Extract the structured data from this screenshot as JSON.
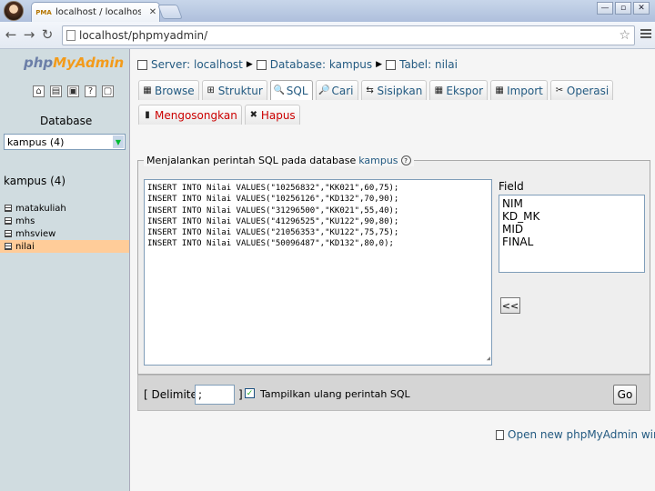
{
  "browser": {
    "tab_title": "localhost / localhost / kampus",
    "tab_close": "✕",
    "url": "localhost/phpmyadmin/",
    "window_buttons": [
      "—",
      "▫",
      "✕"
    ]
  },
  "sidebar": {
    "logo_php": "php",
    "logo_myadmin": "MyAdmin",
    "database_label": "Database",
    "database_select": "kampus (4)",
    "db_name": "kampus (4)",
    "tables": [
      {
        "name": "matakuliah"
      },
      {
        "name": "mhs"
      },
      {
        "name": "mhsview"
      },
      {
        "name": "nilai"
      }
    ]
  },
  "breadcrumb": {
    "server": "Server: localhost",
    "database": "Database: kampus",
    "table": "Tabel: nilai",
    "separator": "▶"
  },
  "tabs_row1": [
    {
      "label": "Browse",
      "icon": "▦"
    },
    {
      "label": "Struktur",
      "icon": "⊞"
    },
    {
      "label": "SQL",
      "icon": "🔍"
    },
    {
      "label": "Cari",
      "icon": "🔎"
    },
    {
      "label": "Sisipkan",
      "icon": "⇆"
    },
    {
      "label": "Ekspor",
      "icon": "▦"
    },
    {
      "label": "Import",
      "icon": "▦"
    },
    {
      "label": "Operasi",
      "icon": "✂"
    }
  ],
  "tabs_row2": [
    {
      "label": "Mengosongkan",
      "icon": "▮"
    },
    {
      "label": "Hapus",
      "icon": "✖"
    }
  ],
  "sql_panel": {
    "legend_text": "Menjalankan perintah SQL pada database",
    "legend_link": "kampus",
    "legend_info": "?",
    "query_lines": [
      "INSERT INTO Nilai VALUES(\"10256832\",\"KK021\",60,75);",
      "INSERT INTO Nilai VALUES(\"10256126\",\"KD132\",70,90);",
      "INSERT INTO Nilai VALUES(\"31296500\",\"KK021\",55,40);",
      "INSERT INTO Nilai VALUES(\"41296525\",\"KU122\",90,80);",
      "INSERT INTO Nilai VALUES(\"21056353\",\"KU122\",75,75);",
      "INSERT INTO Nilai VALUES(\"50096487\",\"KD132\",80,0);"
    ],
    "field_label": "Field",
    "fields": [
      "NIM",
      "KD_MK",
      "MID",
      "FINAL"
    ],
    "field_button": "<<"
  },
  "bottom_bar": {
    "delimiter_label": "[ Delimiter",
    "delimiter_value": ";",
    "delimiter_close": "]",
    "checkbox_mark": "✓",
    "checkbox_label": "Tampilkan ulang perintah SQL",
    "go_button": "Go"
  },
  "footer_link": "Open new phpMyAdmin window"
}
